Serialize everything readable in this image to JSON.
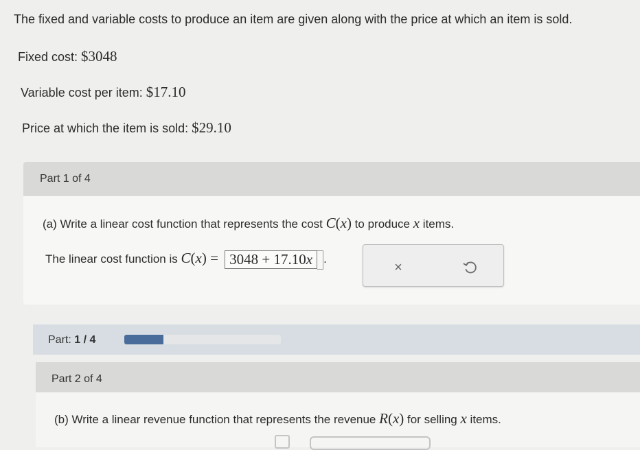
{
  "intro": "The fixed and variable costs to produce an item are given along with the price at which an item is sold.",
  "givens": {
    "fixed_label": "Fixed cost: ",
    "fixed_value": "$3048",
    "variable_label": "Variable cost per item: ",
    "variable_value": "$17.10",
    "price_label": "Price at which the item is sold: ",
    "price_value": "$29.10"
  },
  "part1": {
    "title": "Part 1 of 4",
    "question_prefix": "(a) Write a linear cost function that represents the cost ",
    "question_func": "C",
    "question_var": "x",
    "question_suffix": " to produce ",
    "question_suffix_var": "x",
    "question_end": " items.",
    "answer_prefix": "The linear cost function is ",
    "answer_func": "C",
    "answer_var": "x",
    "answer_equals": " = ",
    "answer_value_num": "3048 + 17.10",
    "answer_value_var": "x",
    "answer_period": "."
  },
  "actions": {
    "clear_icon": "close-icon",
    "clear_glyph": "×",
    "retry_icon": "retry-icon"
  },
  "progress": {
    "label_prefix": "Part: ",
    "label_value": "1 / 4",
    "fraction": 0.25,
    "fill_color": "#4a6c9a"
  },
  "part2": {
    "title": "Part 2 of 4",
    "question_prefix": "(b) Write a linear revenue function that represents the revenue ",
    "question_func": "R",
    "question_var": "x",
    "question_suffix": " for selling ",
    "question_suffix_var": "x",
    "question_end": " items."
  }
}
